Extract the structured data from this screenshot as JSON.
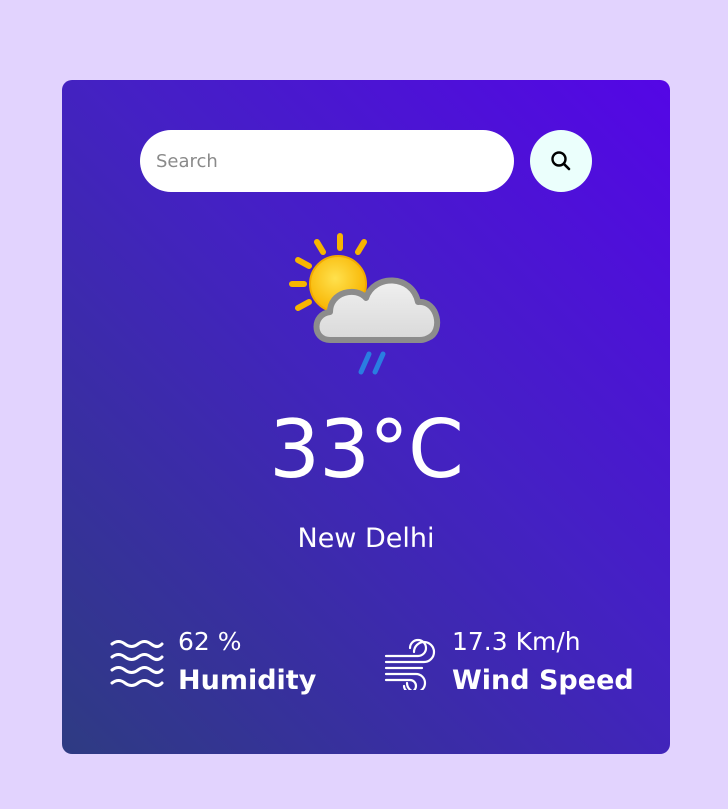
{
  "search": {
    "placeholder": "Search",
    "button_icon": "search-icon"
  },
  "weather": {
    "icon": "partly-cloudy-rain-icon",
    "temperature": "33°C",
    "city": "New Delhi"
  },
  "stats": {
    "humidity": {
      "icon": "waves-icon",
      "value": "62 %",
      "label": "Humidity"
    },
    "wind": {
      "icon": "wind-icon",
      "value": "17.3 Km/h",
      "label": "Wind Speed"
    }
  },
  "colors": {
    "page_background": "#e2d3fe",
    "card_gradient_start": "#5406e6",
    "card_gradient_end": "#2e3b82",
    "search_button_bg": "#ebfffc"
  }
}
